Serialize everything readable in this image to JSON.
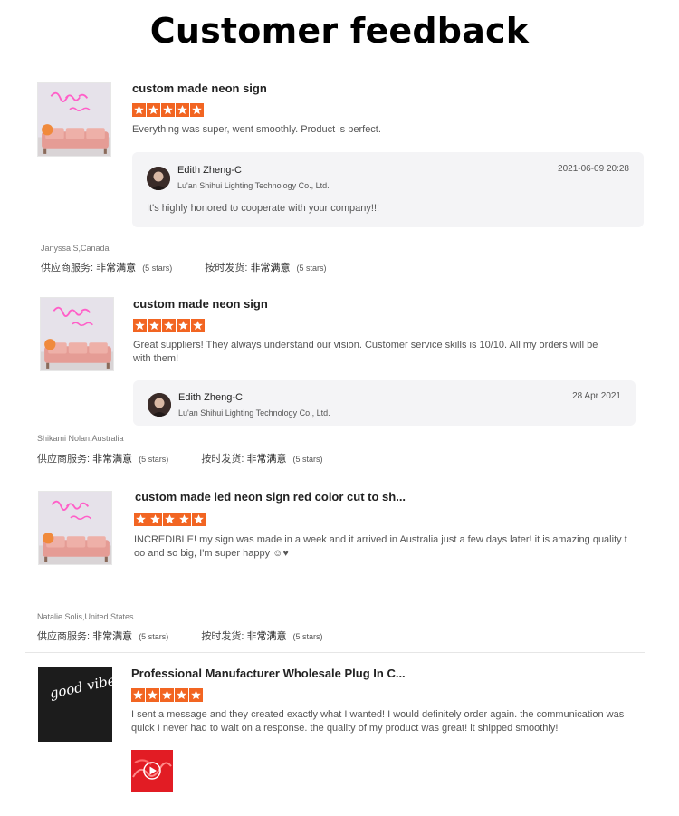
{
  "page_title": "Customer feedback",
  "colors": {
    "star": "#f26522",
    "divider": "#e6e6e6",
    "reply_bg": "#f4f4f6"
  },
  "reviews": [
    {
      "product_title": "custom made neon sign",
      "rating": 5,
      "text": "Everything was super, went smoothly. Product is perfect.",
      "thumbnail": "pink-neon-sign-over-sofa",
      "reply": {
        "name": "Edith Zheng-C",
        "company": "Lu'an Shihui Lighting Technology Co., Ltd.",
        "date": "2021-06-09 20:28",
        "text": "It's highly honored to cooperate with your company!!!"
      },
      "buyer": "Janyssa S,Canada",
      "supplier_service_label": "供应商服务:",
      "supplier_service_value": "非常满意",
      "supplier_service_stars": "(5 stars)",
      "on_time_label": "按时发货:",
      "on_time_value": "非常满意",
      "on_time_stars": "(5 stars)"
    },
    {
      "product_title": "custom made neon sign",
      "rating": 5,
      "text": "Great suppliers! They always understand our vision. Customer service skills is 10/10. All my orders will be with them!",
      "thumbnail": "pink-neon-sign-over-sofa",
      "reply": {
        "name": "Edith Zheng-C",
        "company": "Lu'an Shihui Lighting Technology Co., Ltd.",
        "date": "28 Apr 2021"
      },
      "buyer": "Shikami Nolan,Australia",
      "supplier_service_label": "供应商服务:",
      "supplier_service_value": "非常满意",
      "supplier_service_stars": "(5 stars)",
      "on_time_label": "按时发货:",
      "on_time_value": "非常满意",
      "on_time_stars": "(5 stars)"
    },
    {
      "product_title": "custom made led neon sign red color cut to sh...",
      "rating": 5,
      "text": "INCREDIBLE! my sign was made in a week and it arrived in Australia just a few days later! it is amazing quality too and so big, I'm super happy ☺♥",
      "thumbnail": "pink-neon-sign-over-sofa",
      "buyer": "Natalie Solis,United States",
      "supplier_service_label": "供应商服务:",
      "supplier_service_value": "非常满意",
      "supplier_service_stars": "(5 stars)",
      "on_time_label": "按时发货:",
      "on_time_value": "非常满意",
      "on_time_stars": "(5 stars)"
    },
    {
      "product_title": "Professional Manufacturer Wholesale Plug In C...",
      "rating": 5,
      "text": "I sent a message and they created exactly what I wanted! I would definitely order again. the communication was quick I never had to wait on a response. the quality of my product was great! it shipped smoothly!",
      "thumbnail": "white-neon-good-vibes-only",
      "thumbnail_text": "good vibes only",
      "attachment": "red-neon-video-thumbnail"
    }
  ]
}
